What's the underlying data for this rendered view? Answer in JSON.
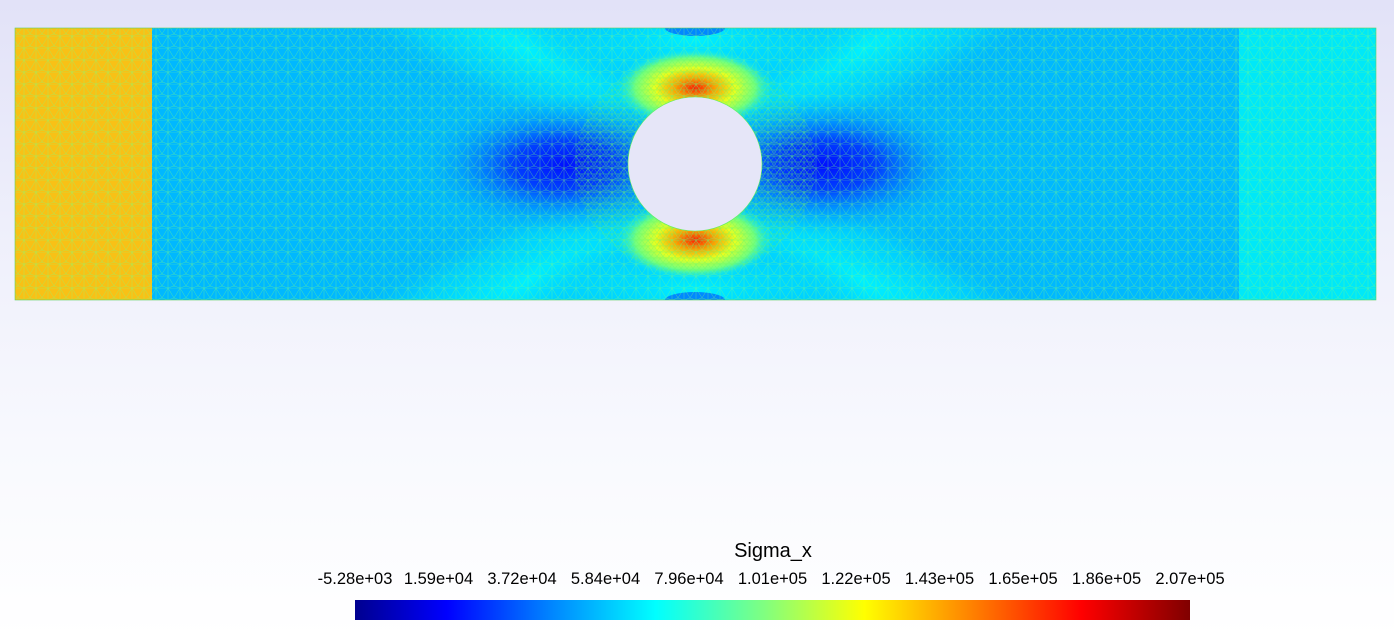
{
  "colorbar": {
    "title": "Sigma_x",
    "min": -5280,
    "max": 207000,
    "ticks": [
      "-5.28e+03",
      "1.59e+04",
      "3.72e+04",
      "5.84e+04",
      "7.96e+04",
      "1.01e+05",
      "1.22e+05",
      "1.43e+05",
      "1.65e+05",
      "1.86e+05",
      "2.07e+05"
    ],
    "colormap": "jet"
  },
  "colors": {
    "background_top": "#e2e2f8",
    "background_bottom": "#ffffff",
    "left_grip_region": "#ffc000",
    "right_grip_region": "#00ffff",
    "hole_fill": "#e5e5f8"
  }
}
